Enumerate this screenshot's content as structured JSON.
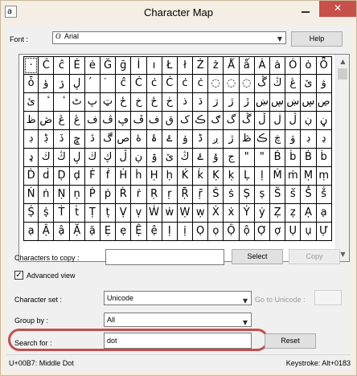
{
  "window": {
    "title": "Character Map",
    "minimize_glyph": "",
    "close_glyph": "✕",
    "app_icon_glyph": "a"
  },
  "font_row": {
    "label": "Font :",
    "icon_glyph": "O",
    "value": "Arial",
    "help_label": "Help"
  },
  "grid": {
    "rows": [
      [
        "·",
        "Ĉ",
        "ĉ",
        "Ė",
        "ė",
        "Ğ",
        "ğ",
        "İ",
        "ı",
        "Ł",
        "ł",
        "Ż",
        "ż",
        "Ǻ",
        "ǻ",
        "Ȧ",
        "ȧ",
        "Ȯ",
        "ȯ",
        "Ȫ"
      ],
      [
        "ȱ",
        "ؤ",
        "ۯ",
        "ڸ",
        "́",
        "̇",
        "ĉ",
        "Ċ",
        "ċ",
        "Ċ",
        "ċ",
        "ċ",
        "◌",
        "◌",
        "◌",
        "ڴ",
        "ڭ",
        "ڠ",
        "ێ",
        "ۋ"
      ],
      [
        "ئ",
        "ٔ",
        "ٔ",
        "ٹ",
        "پ",
        "ټ",
        "ځ",
        "خ",
        "ځ",
        "ڂ",
        "ذ",
        "ڌ",
        "ڗ",
        "ژ",
        "ڙ",
        "ښ",
        "ڛ",
        "ښ",
        "ڛ",
        "ڝ"
      ],
      [
        "ظ",
        "ڞ",
        "ڠ",
        "ڠ",
        "ف",
        "ڤ",
        "ڥ",
        "ڦ",
        "ف",
        "ق",
        "ک",
        "ڪ",
        "ګ",
        "گ",
        "ڴ",
        "ڵ",
        "ڶ",
        "ڷ",
        "ڹ",
        "ڼ"
      ],
      [
        "ڊ",
        "ڋ",
        "ڏ",
        "ݘ",
        "ڎ",
        "ڰ",
        "ص",
        "ۀ",
        "ۂ",
        "ۓ",
        "ۏ",
        "ڈ",
        "ږ",
        "ژ",
        "ڟ",
        "ڪ",
        "ڿ",
        "ۋ",
        "ڊ",
        "ڍ"
      ],
      [
        "ډ",
        "ڬ",
        "ڭ",
        "ڸ",
        "ڬ",
        "ڮ",
        "ڷ",
        "ڹ",
        "ۊ",
        "ێ",
        "ڭ",
        "ۓ",
        "ۇ",
        "ج",
        "\"",
        "\"",
        "Ḃ",
        "ḃ",
        "Ḃ",
        "ḃ"
      ],
      [
        "Ḋ",
        "ḋ",
        "Ḍ",
        "ḍ",
        "Ḟ",
        "ḟ",
        "Ḣ",
        "ḣ",
        "Ḥ",
        "ḥ",
        "Ḱ",
        "ḱ",
        "Ḳ",
        "ḳ",
        "Ḷ",
        "ḷ",
        "Ṁ",
        "ṁ",
        "Ṃ",
        "ṃ"
      ],
      [
        "Ṅ",
        "ṅ",
        "Ṇ",
        "ṇ",
        "Ṗ",
        "ṗ",
        "Ṙ",
        "ṙ",
        "Ṛ",
        "ṛ",
        "Ṝ",
        "ṝ",
        "Ṡ",
        "ṡ",
        "Ṣ",
        "ṣ",
        "Ṥ",
        "ṥ",
        "Ṧ",
        "ṧ"
      ],
      [
        "Ṩ",
        "ṩ",
        "Ṫ",
        "ṫ",
        "Ṭ",
        "ṭ",
        "Ṿ",
        "ṿ",
        "Ẇ",
        "ẇ",
        "Ẉ",
        "ẉ",
        "Ẋ",
        "ẋ",
        "Ẏ",
        "ẏ",
        "Ẓ",
        "ẓ",
        "Ạ",
        "ạ"
      ],
      [
        "ạ",
        "Ậ",
        "ậ",
        "Ặ",
        "ặ",
        "Ẹ",
        "ẹ",
        "Ệ",
        "ệ",
        "Ị",
        "ị",
        "Ọ",
        "ọ",
        "Ộ",
        "ộ",
        "Ợ",
        "ợ",
        "Ụ",
        "ụ",
        "Ự"
      ]
    ]
  },
  "scrollbar": {
    "up_glyph": "▲",
    "down_glyph": "▼"
  },
  "copy_row": {
    "label": "Characters to copy :",
    "value": "",
    "select_label": "Select",
    "copy_label": "Copy"
  },
  "advanced": {
    "checked_glyph": "✓",
    "label": "Advanced view",
    "checked": true
  },
  "charset_row": {
    "label": "Character set :",
    "value": "Unicode",
    "goto_label": "Go to Unicode :",
    "goto_value": ""
  },
  "groupby_row": {
    "label": "Group by :",
    "value": "All"
  },
  "search_row": {
    "label": "Search for :",
    "value": "dot",
    "reset_label": "Reset"
  },
  "status": {
    "left": "U+00B7: Middle Dot",
    "right": "Keystroke: Alt+0183"
  },
  "dropdown_arrow_glyph": "▼",
  "colors": {
    "highlight_ring": "#c0504d",
    "close_button": "#c7504b"
  }
}
